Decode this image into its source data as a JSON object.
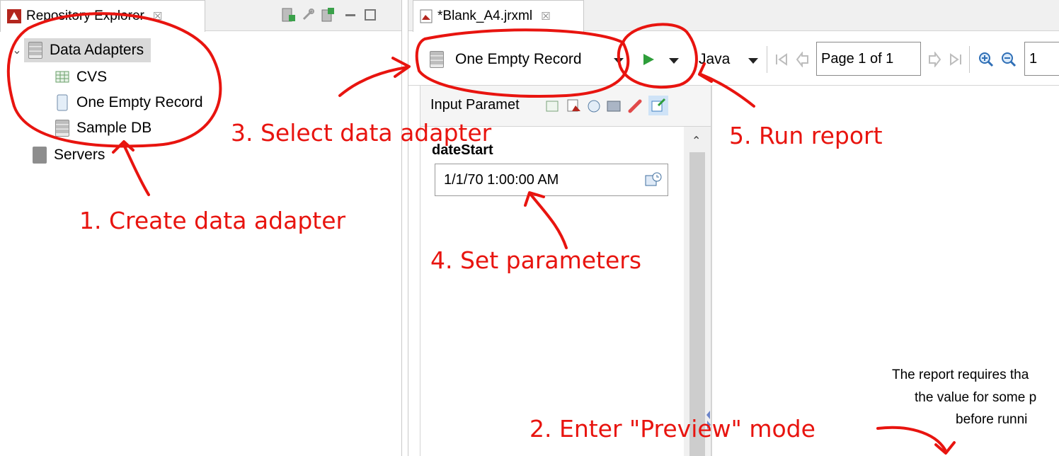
{
  "repository_explorer": {
    "tab_title": "Repository Explorer",
    "close_glyph": "☒",
    "tree": {
      "data_adapters_label": "Data Adapters",
      "adapters": [
        "CVS",
        "One Empty Record",
        "Sample DB"
      ],
      "servers_label": "Servers"
    }
  },
  "editor": {
    "tab_title": "*Blank_A4.jrxml",
    "close_glyph": "☒",
    "toolbar": {
      "data_adapter_selected": "One Empty Record",
      "language_selected": "Java",
      "page_indicator": "Page 1 of 1",
      "zoom_value": "1"
    },
    "input_parameters": {
      "header_label": "Input Paramet",
      "param_name": "dateStart",
      "param_value": "1/1/70 1:00:00 AM"
    },
    "preview_message": {
      "line1": "The report requires tha",
      "line2": "the value for some p",
      "line3": "before runni"
    }
  },
  "annotations": {
    "step1": "1. Create data adapter",
    "step2": "2. Enter \"Preview\" mode",
    "step3": "3. Select data adapter",
    "step4": "4. Set parameters",
    "step5": "5. Run report"
  },
  "colors": {
    "annotation_red": "#e8140f",
    "run_green": "#2e9e3a"
  }
}
